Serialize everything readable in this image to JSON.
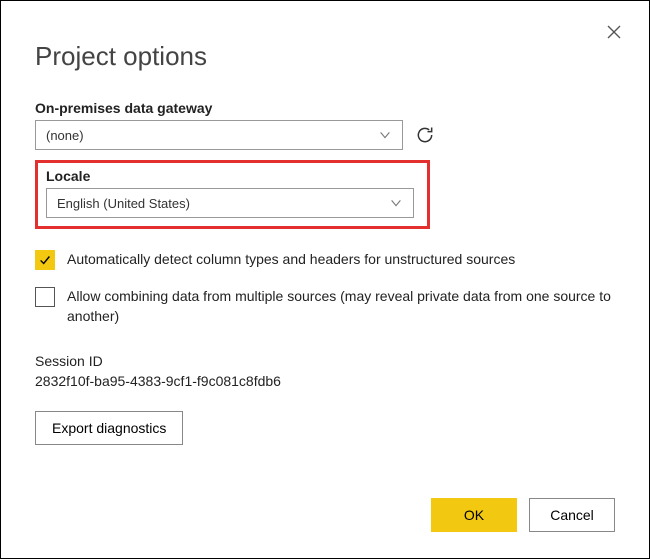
{
  "title": "Project options",
  "gateway": {
    "label": "On-premises data gateway",
    "selected": "(none)"
  },
  "locale": {
    "label": "Locale",
    "selected": "English (United States)"
  },
  "options": {
    "auto_detect": {
      "label": "Automatically detect column types and headers for unstructured sources",
      "checked": true
    },
    "allow_combine": {
      "label": "Allow combining data from multiple sources (may reveal private data from one source to another)",
      "checked": false
    }
  },
  "session": {
    "label": "Session ID",
    "value": "2832f10f-ba95-4383-9cf1-f9c081c8fdb6"
  },
  "buttons": {
    "export": "Export diagnostics",
    "ok": "OK",
    "cancel": "Cancel"
  }
}
